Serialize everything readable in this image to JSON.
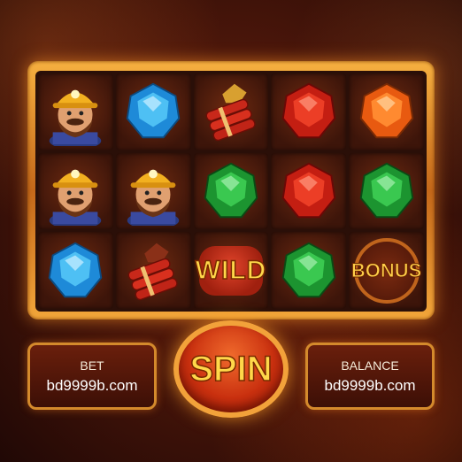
{
  "reels": [
    [
      "miner",
      "blue-gem",
      "dynamite",
      "red-gem",
      "orange-gem"
    ],
    [
      "miner",
      "miner",
      "green-gem",
      "red-gem",
      "green-gem"
    ],
    [
      "blue-gem",
      "dynamite",
      "wild",
      "green-gem",
      "bonus"
    ]
  ],
  "symbols": {
    "wild_label": "WILD",
    "bonus_label": "BONUS"
  },
  "controls": {
    "bet_label": "BET",
    "bet_value": "bd9999b.com",
    "spin_label": "SPIN",
    "balance_label": "BALANCE",
    "balance_value": "bd9999b.com"
  },
  "colors": {
    "frame_gold": "#f2a63a",
    "spin_red": "#c9300f",
    "text_gold": "#ffd84a",
    "blue_gem": "#2a9ee0",
    "red_gem": "#d8281a",
    "green_gem": "#25a83a",
    "orange_gem": "#f06a18"
  }
}
